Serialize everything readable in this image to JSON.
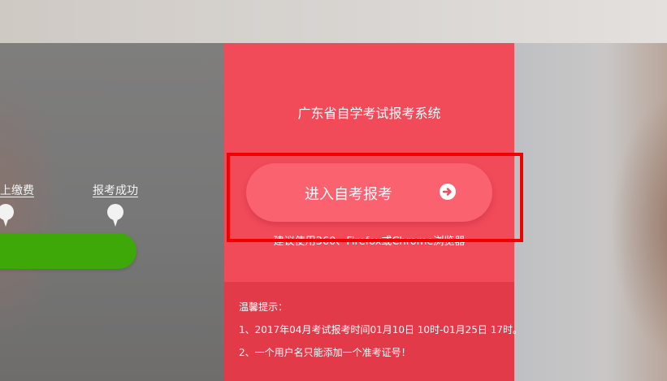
{
  "progress": {
    "steps": [
      {
        "label": "上缴费"
      },
      {
        "label": "报考成功"
      }
    ],
    "bar_color": "#3ea808"
  },
  "panel": {
    "title": "广东省自学考试报考系统",
    "enter_button": {
      "label": "进入自考报考",
      "icon": "arrow-right-circle-icon"
    },
    "browser_hint": "建议使用360、Firefox或Chrome浏览器",
    "tips": {
      "title": "温馨提示：",
      "items": [
        "1、2017年04月考试报考时间01月10日 10时-01月25日 17时。",
        "2、一个用户名只能添加一个准考证号！"
      ]
    },
    "colors": {
      "panel": "#f14b5a",
      "button": "#fb626f",
      "tips_bg": "#e33a49",
      "highlight": "#f20000"
    }
  }
}
